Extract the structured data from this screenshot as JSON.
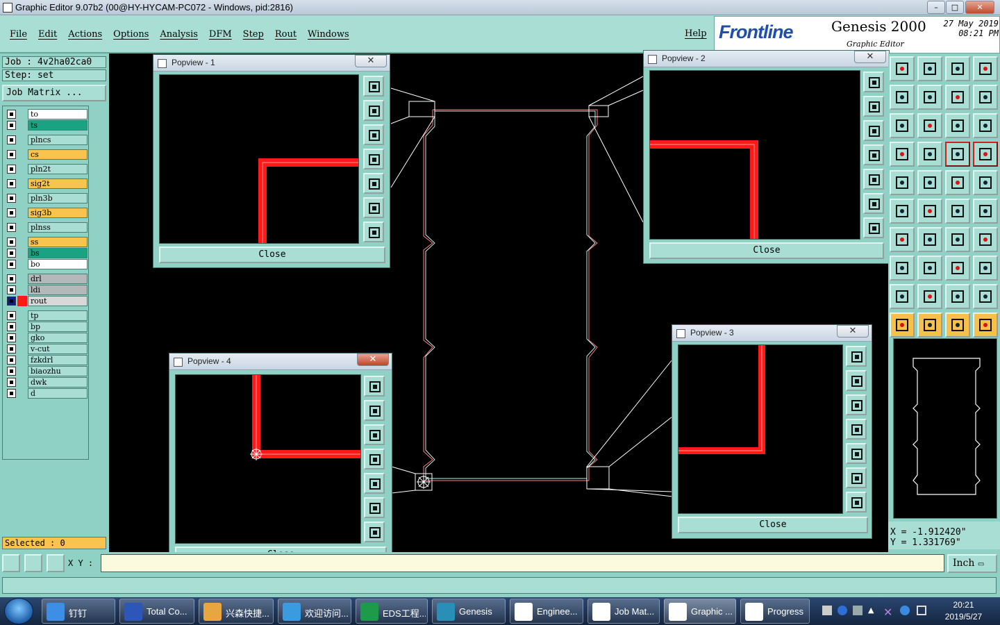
{
  "window": {
    "title": "Graphic Editor 9.07b2 (00@HY-HYCAM-PC072 - Windows, pid:2816)",
    "min_label": "–",
    "max_label": "□",
    "close_label": "✕"
  },
  "menu": {
    "items": [
      "File",
      "Edit",
      "Actions",
      "Options",
      "Analysis",
      "DFM",
      "Step",
      "Rout",
      "Windows"
    ],
    "help": "Help"
  },
  "logo": {
    "brand": "Frontline",
    "product": "Genesis 2000",
    "subtitle": "Graphic Editor",
    "date": "27 May 2019",
    "time": "08:21 PM"
  },
  "job": {
    "job_label": "Job  :  4v2ha02ca0",
    "step_label": "Step:  set",
    "matrix_button": "Job Matrix ..."
  },
  "layers": [
    {
      "name": "to",
      "color": "#ffffff"
    },
    {
      "name": "ts",
      "color": "#1aa383"
    },
    {
      "name": "plncs",
      "color": "#a9ded4"
    },
    {
      "name": "cs",
      "color": "#f9c44e"
    },
    {
      "name": "pln2t",
      "color": "#a9ded4"
    },
    {
      "name": "sig2t",
      "color": "#f9c44e"
    },
    {
      "name": "pln3b",
      "color": "#a9ded4"
    },
    {
      "name": "sig3b",
      "color": "#f9c44e"
    },
    {
      "name": "plnss",
      "color": "#a9ded4"
    },
    {
      "name": "ss",
      "color": "#f9c44e"
    },
    {
      "name": "bs",
      "color": "#1aa383"
    },
    {
      "name": "bo",
      "color": "#ffffff"
    },
    {
      "name": "drl",
      "color": "#b5b8b8"
    },
    {
      "name": "ldi",
      "color": "#b5b8b8"
    },
    {
      "name": "rout",
      "color": "#d8d8d8",
      "active": true
    },
    {
      "name": "tp",
      "color": "#a9ded4"
    },
    {
      "name": "bp",
      "color": "#a9ded4"
    },
    {
      "name": "gko",
      "color": "#a9ded4"
    },
    {
      "name": "v-cut",
      "color": "#a9ded4"
    },
    {
      "name": "fzkdrl",
      "color": "#a9ded4"
    },
    {
      "name": "biaozhu",
      "color": "#a9ded4"
    },
    {
      "name": "dwk",
      "color": "#a9ded4"
    },
    {
      "name": "d",
      "color": "#a9ded4"
    }
  ],
  "status": {
    "selected": "Selected : 0",
    "xy_label": "X Y :",
    "xy_value": "",
    "units": "Inch",
    "units_arrow": "▭",
    "coord_x": "X  =  -1.912420\"",
    "coord_y": "Y  =  1.331769\""
  },
  "popviews": [
    {
      "title": "Popview - 1",
      "close": "Close"
    },
    {
      "title": "Popview - 2",
      "close": "Close"
    },
    {
      "title": "Popview - 3",
      "close": "Close"
    },
    {
      "title": "Popview - 4",
      "close": "Close"
    }
  ],
  "taskbar": {
    "items": [
      {
        "label": "钉钉",
        "icon": "dingtalk-icon",
        "color": "#3d8fe6"
      },
      {
        "label": "Total Co...",
        "icon": "floppy-icon",
        "color": "#2c57b8"
      },
      {
        "label": "兴森快捷...",
        "icon": "shell-icon",
        "color": "#e8a640"
      },
      {
        "label": "欢迎访问...",
        "icon": "ie-icon",
        "color": "#3a9be0"
      },
      {
        "label": "EDS工程...",
        "icon": "eds-icon",
        "color": "#1d9a4a"
      },
      {
        "label": "Genesis",
        "icon": "genesis-icon",
        "color": "#2a8fb6"
      },
      {
        "label": "Enginee...",
        "icon": "x-window-icon",
        "color": "#ffffff"
      },
      {
        "label": "Job Mat...",
        "icon": "x-window-icon",
        "color": "#ffffff"
      },
      {
        "label": "Graphic ...",
        "icon": "x-window-icon",
        "color": "#ffffff"
      },
      {
        "label": "Progress",
        "icon": "x-window-icon",
        "color": "#ffffff"
      }
    ],
    "clock_time": "20:21",
    "clock_date": "2019/5/27"
  },
  "colors": {
    "panel": "#8fd1c4",
    "button": "#a9ded4",
    "highlight": "#f6c04a",
    "trace": "#ff1a1a",
    "outline": "#ff7777"
  }
}
